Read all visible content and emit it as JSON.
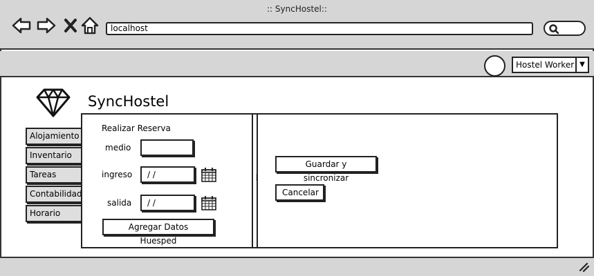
{
  "window": {
    "title": ":: SyncHostel::"
  },
  "browser": {
    "url": "localhost",
    "icons": [
      "back-arrow-icon",
      "forward-arrow-icon",
      "close-x-icon",
      "home-icon",
      "search-icon"
    ]
  },
  "header": {
    "user_label": "Hostel Worker",
    "dropdown_icon": "caret-down-icon"
  },
  "app": {
    "title": "SyncHostel",
    "logo_icon": "diamond-icon"
  },
  "sidebar": {
    "items": [
      {
        "label": "Alojamiento"
      },
      {
        "label": "Inventario"
      },
      {
        "label": "Tareas"
      },
      {
        "label": "Contabilidad"
      },
      {
        "label": "Horario"
      }
    ]
  },
  "form": {
    "heading": "Realizar Reserva",
    "medio_label": "medio",
    "medio_value": "",
    "ingreso_label": "ingreso",
    "ingreso_value": "/  /",
    "salida_label": "salida",
    "salida_value": "/  /",
    "add_guest_label": "Agregar Datos Huesped",
    "calendar_icon": "calendar-icon"
  },
  "actions": {
    "save_label": "Guardar y sincronizar",
    "cancel_label": "Cancelar"
  },
  "colors": {
    "chrome": "#d6d6d6",
    "tab": "#dedede",
    "stroke": "#222222"
  }
}
